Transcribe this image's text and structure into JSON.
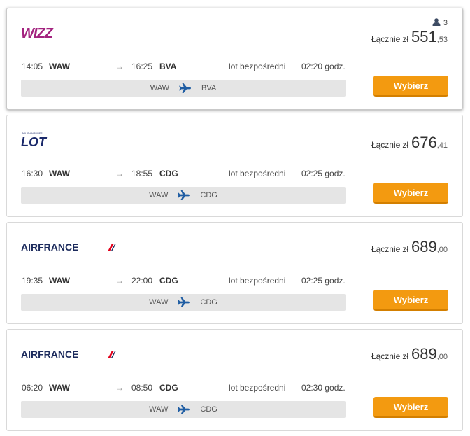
{
  "accent": "#f39a10",
  "flights": [
    {
      "airline": "Wizz Air",
      "logo_text": "WIZZ",
      "passengers": "3",
      "total_label": "Łącznie",
      "currency": "zł",
      "price_main": "551",
      "price_dec": ",53",
      "dep_time": "14:05",
      "dep_code": "WAW",
      "arr_time": "16:25",
      "arr_code": "BVA",
      "stops": "lot bezpośredni",
      "duration": "02:20 godz.",
      "route_from": "WAW",
      "route_to": "BVA",
      "button": "Wybierz"
    },
    {
      "airline": "LOT Polish Airlines",
      "logo_text": "LOT",
      "logo_subtext": "POLISH AIRLINES",
      "total_label": "Łącznie",
      "currency": "zł",
      "price_main": "676",
      "price_dec": ",41",
      "dep_time": "16:30",
      "dep_code": "WAW",
      "arr_time": "18:55",
      "arr_code": "CDG",
      "stops": "lot bezpośredni",
      "duration": "02:25 godz.",
      "route_from": "WAW",
      "route_to": "CDG",
      "button": "Wybierz"
    },
    {
      "airline": "Air France",
      "logo_text": "AIRFRANCE",
      "total_label": "Łącznie",
      "currency": "zł",
      "price_main": "689",
      "price_dec": ",00",
      "dep_time": "19:35",
      "dep_code": "WAW",
      "arr_time": "22:00",
      "arr_code": "CDG",
      "stops": "lot bezpośredni",
      "duration": "02:25 godz.",
      "route_from": "WAW",
      "route_to": "CDG",
      "button": "Wybierz"
    },
    {
      "airline": "Air France",
      "logo_text": "AIRFRANCE",
      "total_label": "Łącznie",
      "currency": "zł",
      "price_main": "689",
      "price_dec": ",00",
      "dep_time": "06:20",
      "dep_code": "WAW",
      "arr_time": "08:50",
      "arr_code": "CDG",
      "stops": "lot bezpośredni",
      "duration": "02:30 godz.",
      "route_from": "WAW",
      "route_to": "CDG",
      "button": "Wybierz"
    }
  ]
}
